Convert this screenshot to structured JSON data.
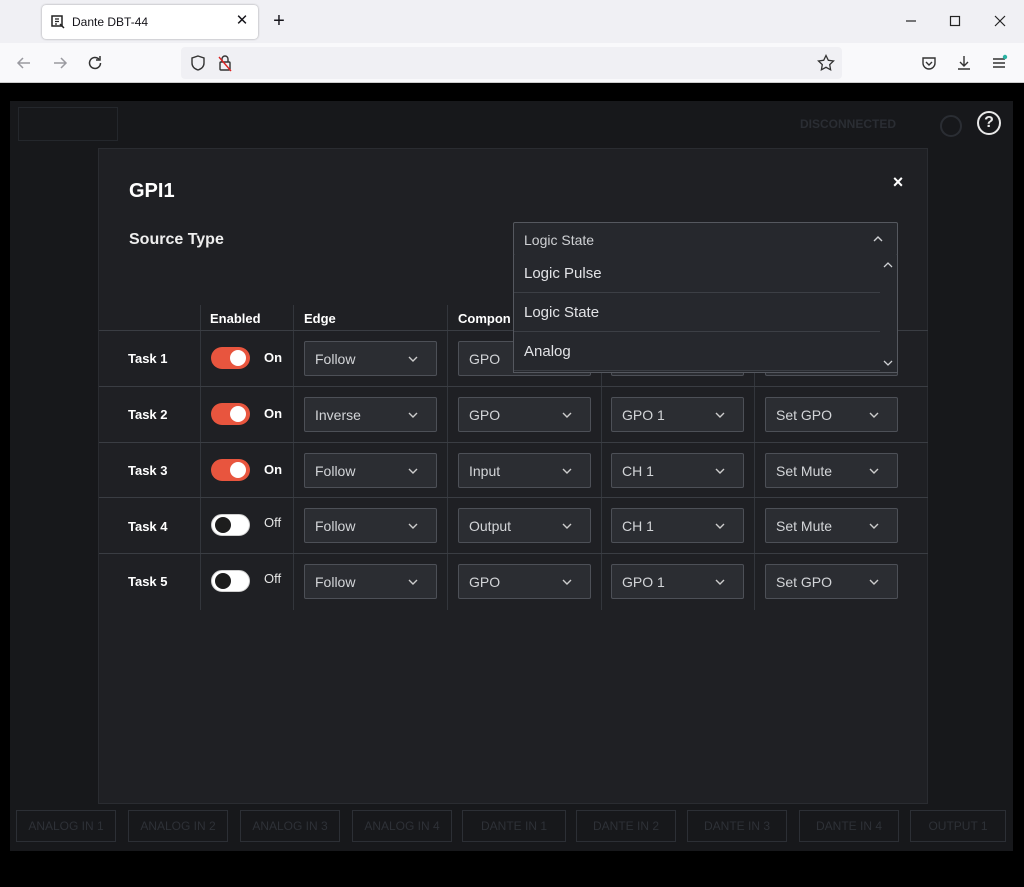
{
  "browser": {
    "tab_title": "Dante DBT-44",
    "new_tab": "+"
  },
  "modal": {
    "title": "GPI1",
    "close": "×",
    "source_type_label": "Source Type",
    "source_type_value": "Logic State",
    "source_type_options": [
      "Logic Pulse",
      "Logic State",
      "Analog"
    ],
    "columns": [
      "Enabled",
      "Edge",
      "Compon"
    ],
    "tasks": [
      {
        "label": "Task 1",
        "enabled": "On",
        "edge": "Follow",
        "component": "GPO",
        "target": "",
        "action": ""
      },
      {
        "label": "Task 2",
        "enabled": "On",
        "edge": "Inverse",
        "component": "GPO",
        "target": "GPO 1",
        "action": "Set GPO"
      },
      {
        "label": "Task 3",
        "enabled": "On",
        "edge": "Follow",
        "component": "Input",
        "target": "CH 1",
        "action": "Set Mute"
      },
      {
        "label": "Task 4",
        "enabled": "Off",
        "edge": "Follow",
        "component": "Output",
        "target": "CH 1",
        "action": "Set Mute"
      },
      {
        "label": "Task 5",
        "enabled": "Off",
        "edge": "Follow",
        "component": "GPO",
        "target": "GPO 1",
        "action": "Set GPO"
      }
    ]
  },
  "background": {
    "status": "DISCONNECTED",
    "bottom_tabs": [
      "ANALOG IN 1",
      "ANALOG IN 2",
      "ANALOG IN 3",
      "ANALOG IN 4",
      "DANTE IN 1",
      "DANTE IN 2",
      "DANTE IN 3",
      "DANTE IN 4",
      "OUTPUT 1"
    ],
    "help": "?"
  },
  "colors": {
    "accent": "#e8553e",
    "modal_bg": "#1f2024",
    "control_bg": "#2b2d32"
  }
}
